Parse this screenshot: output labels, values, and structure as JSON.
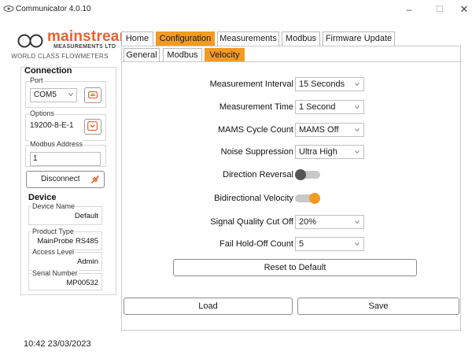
{
  "window": {
    "title": "Communicator 4.0.10",
    "controls": {
      "minimize": "–",
      "maximize": "☐",
      "close": "✕"
    }
  },
  "brand": {
    "name": "mainstream",
    "subtitle": "MEASUREMENTS LTD",
    "tagline": "WORLD CLASS FLOWMETERS",
    "color": "#e8612c"
  },
  "accent_color": "#f39a23",
  "sidebar": {
    "connection_title": "Connection",
    "port": {
      "label": "Port",
      "value": "COM5",
      "refresh_icon": "refresh-icon"
    },
    "options": {
      "label": "Options",
      "value": "19200-8-E-1",
      "expand_icon": "chevron-down-icon"
    },
    "modbus_address": {
      "label": "Modbus Address",
      "value": "1"
    },
    "disconnect": {
      "label": "Disconnect",
      "icon": "plug-icon"
    },
    "device_title": "Device",
    "device_fields": [
      {
        "label": "Device Name",
        "value": "Default"
      },
      {
        "label": "Product Type",
        "value": "MainProbe RS485"
      },
      {
        "label": "Access Level",
        "value": "Admin"
      },
      {
        "label": "Serial Number",
        "value": "MP00532"
      }
    ]
  },
  "main_tabs": [
    {
      "label": "Home",
      "active": false
    },
    {
      "label": "Configuration",
      "active": true
    },
    {
      "label": "Measurements",
      "active": false
    },
    {
      "label": "Modbus",
      "active": false
    },
    {
      "label": "Firmware Update",
      "active": false
    }
  ],
  "sub_tabs": [
    {
      "label": "General",
      "active": false
    },
    {
      "label": "Modbus",
      "active": false
    },
    {
      "label": "Velocity",
      "active": true
    }
  ],
  "velocity_form": {
    "measurement_interval": {
      "label": "Measurement Interval",
      "value": "15 Seconds"
    },
    "measurement_time": {
      "label": "Measurement Time",
      "value": "1 Second"
    },
    "mams_cycle_count": {
      "label": "MAMS Cycle Count",
      "value": "MAMS Off"
    },
    "noise_suppression": {
      "label": "Noise Suppression",
      "value": "Ultra High"
    },
    "direction_reversal": {
      "label": "Direction Reversal",
      "on": false
    },
    "bidirectional_velocity": {
      "label": "Bidirectional Velocity",
      "on": true
    },
    "signal_quality_cut_off": {
      "label": "Signal Quality Cut Off",
      "value": "20%"
    },
    "fail_hold_off_count": {
      "label": "Fail Hold-Off Count",
      "value": "5"
    },
    "reset_label": "Reset to Default"
  },
  "actions": {
    "load_label": "Load",
    "save_label": "Save"
  },
  "status": {
    "datetime": "10:42 23/03/2023"
  }
}
